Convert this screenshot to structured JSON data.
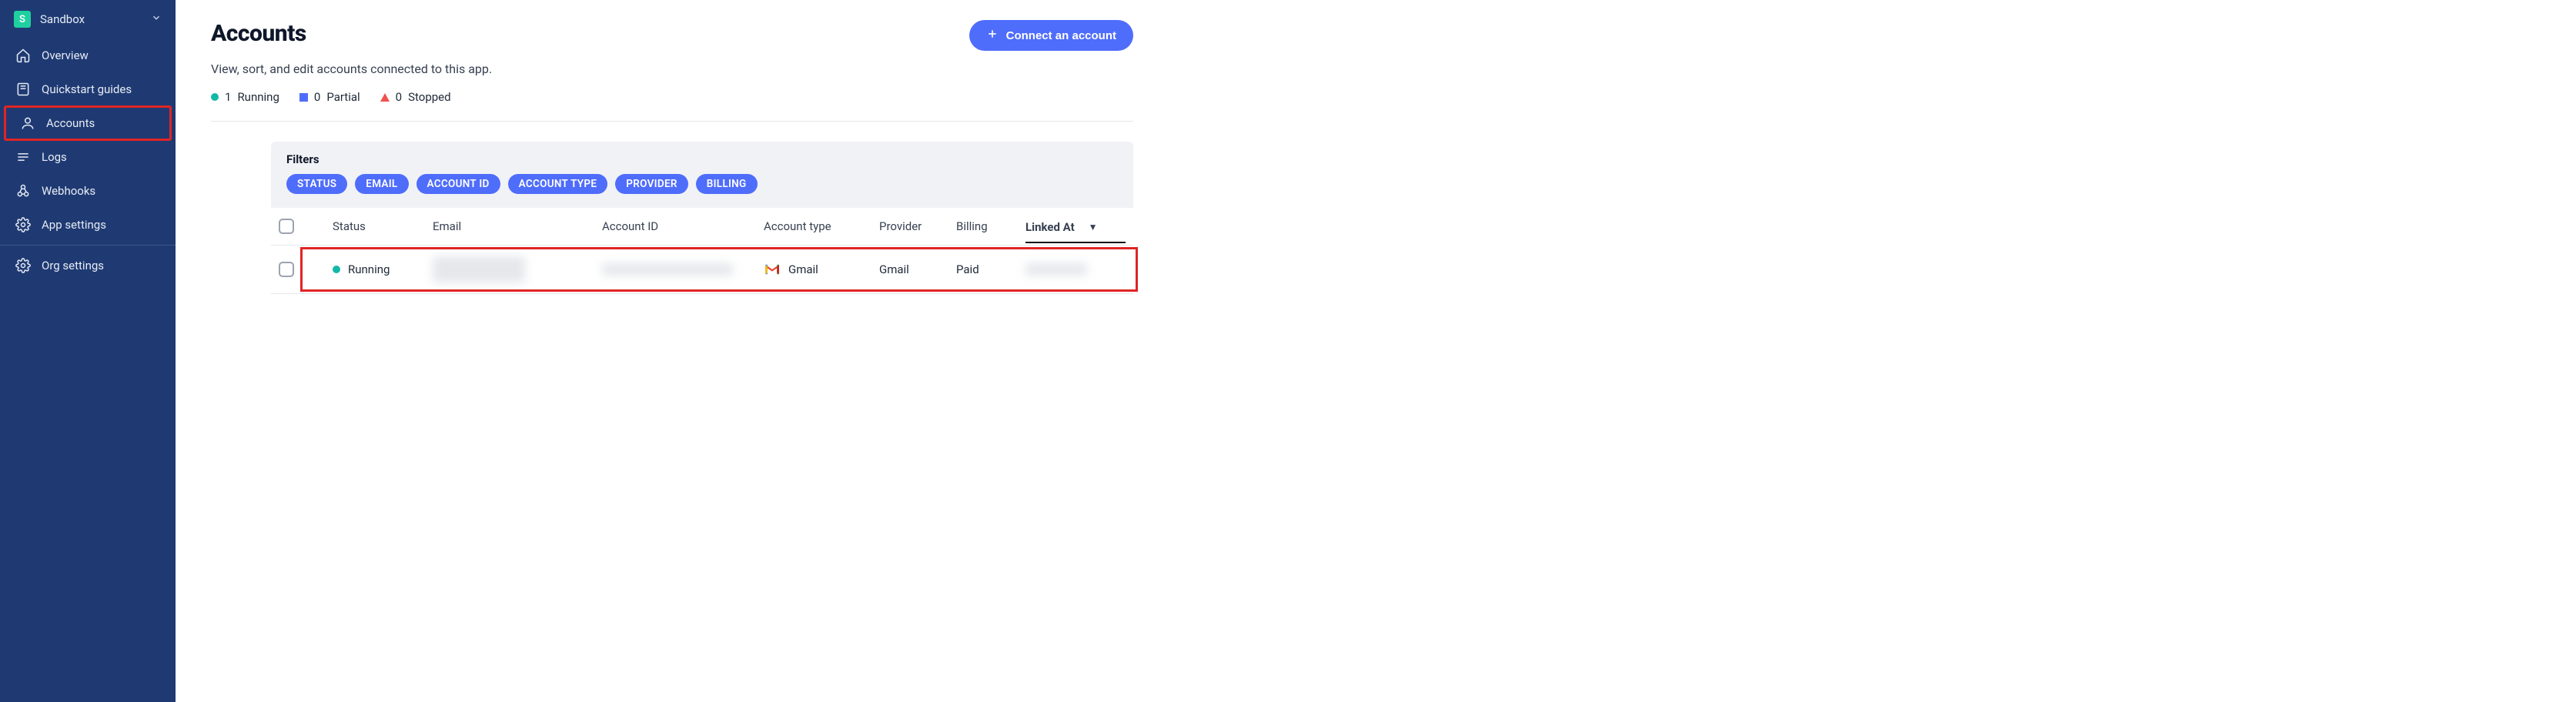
{
  "env": {
    "badge": "S",
    "name": "Sandbox"
  },
  "sidebar": {
    "items": [
      {
        "icon": "home",
        "label": "Overview"
      },
      {
        "icon": "book",
        "label": "Quickstart guides"
      },
      {
        "icon": "user",
        "label": "Accounts",
        "active": true
      },
      {
        "icon": "list",
        "label": "Logs"
      },
      {
        "icon": "webhook",
        "label": "Webhooks"
      },
      {
        "icon": "gear",
        "label": "App settings"
      }
    ],
    "org": {
      "icon": "gear",
      "label": "Org settings"
    }
  },
  "page": {
    "title": "Accounts",
    "subtitle": "View, sort, and edit accounts connected to this app.",
    "connect_label": "Connect an account"
  },
  "summary": {
    "running": {
      "count": "1",
      "label": "Running"
    },
    "partial": {
      "count": "0",
      "label": "Partial"
    },
    "stopped": {
      "count": "0",
      "label": "Stopped"
    }
  },
  "filters": {
    "title": "Filters",
    "chips": [
      "STATUS",
      "EMAIL",
      "ACCOUNT ID",
      "ACCOUNT TYPE",
      "PROVIDER",
      "BILLING"
    ]
  },
  "table": {
    "columns": [
      "Status",
      "Email",
      "Account ID",
      "Account type",
      "Provider",
      "Billing",
      "Linked At"
    ],
    "sort_col": "Linked At",
    "rows": [
      {
        "status": "Running",
        "email": "",
        "account_id": "",
        "account_type": "Gmail",
        "provider": "Gmail",
        "billing": "Paid",
        "linked_at": ""
      }
    ]
  }
}
